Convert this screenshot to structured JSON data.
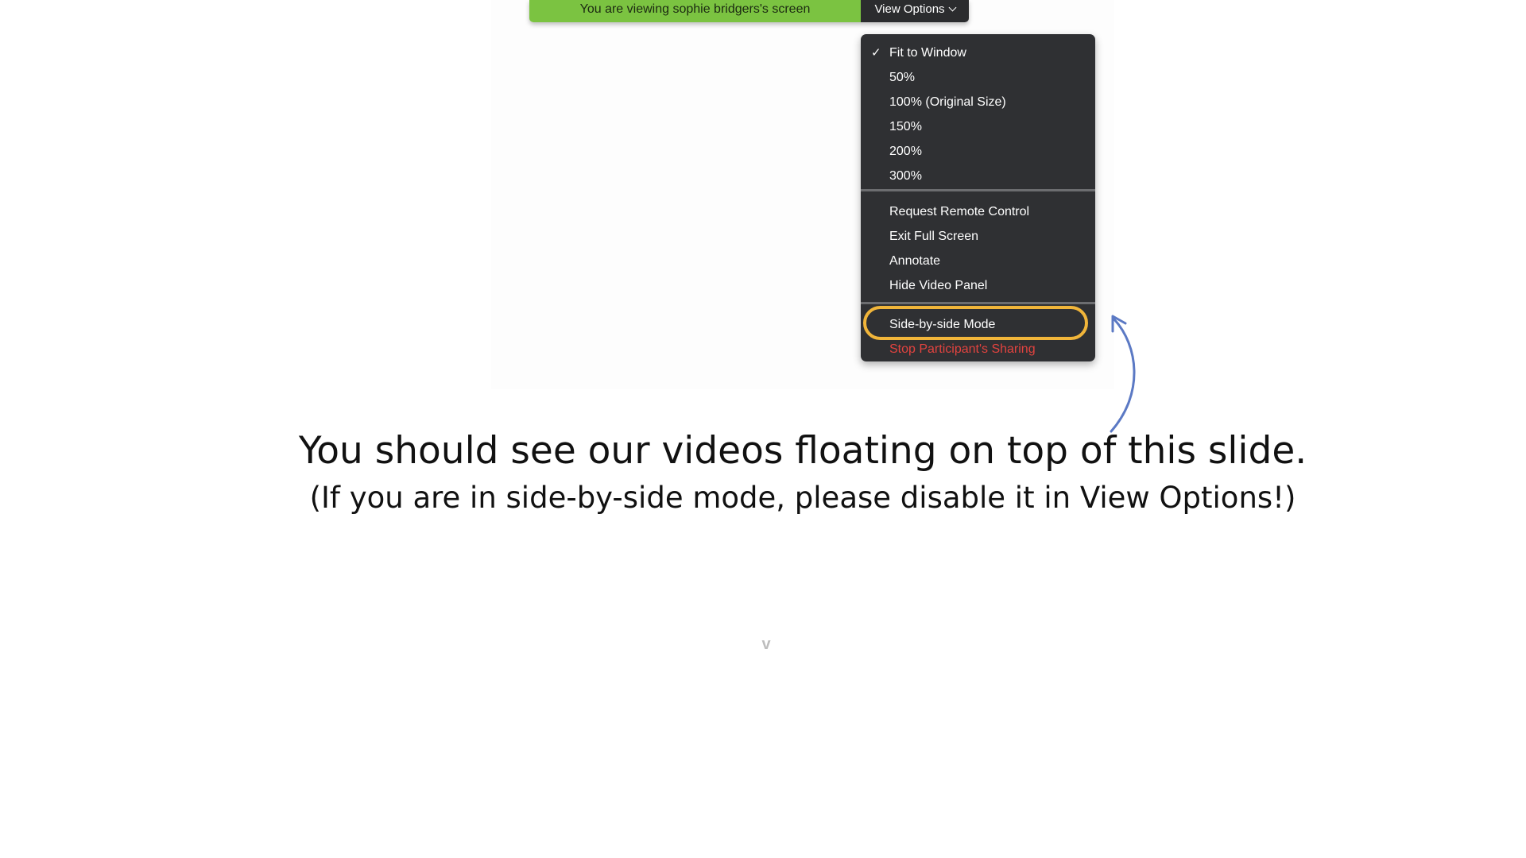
{
  "share_bar": {
    "banner_text": "You are viewing sophie bridgers's screen",
    "view_options_label": "View Options",
    "banner_color": "#7bc341"
  },
  "menu": {
    "zoom_items": [
      {
        "label": "Fit to Window",
        "checked": true
      },
      {
        "label": "50%"
      },
      {
        "label": "100% (Original Size)"
      },
      {
        "label": "150%"
      },
      {
        "label": "200%"
      },
      {
        "label": "300%"
      }
    ],
    "action_items": [
      {
        "label": "Request Remote Control"
      },
      {
        "label": "Exit Full Screen"
      },
      {
        "label": "Annotate"
      },
      {
        "label": "Hide Video Panel"
      }
    ],
    "mode_items": [
      {
        "label": "Side-by-side Mode",
        "highlighted": true
      },
      {
        "label": "Stop Participant's Sharing",
        "color": "#e2433f"
      }
    ],
    "check_glyph": "✓"
  },
  "slide": {
    "headline": "You should see our videos floating on top of this slide.",
    "subline": "(If you are in side-by-side mode, please disable it in View Options!)",
    "caret": "v",
    "highlight_color": "#f1b53a",
    "arrow_color": "#5b79c4"
  }
}
